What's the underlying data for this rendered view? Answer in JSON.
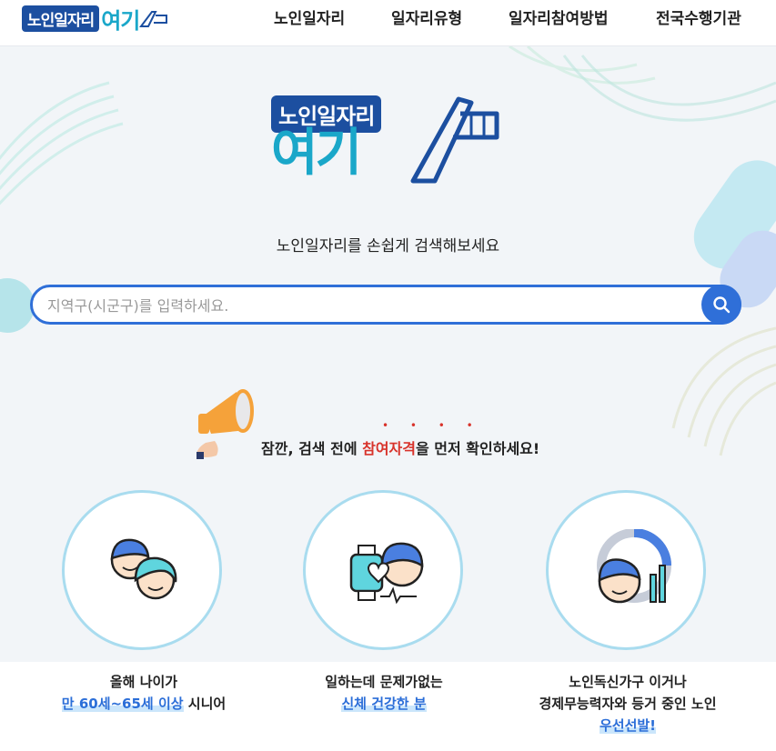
{
  "header": {
    "logo_tag": "노인일자리",
    "logo_big": "여기",
    "nav": [
      "노인일자리",
      "일자리유형",
      "일자리참여방법",
      "전국수행기관"
    ]
  },
  "hero": {
    "logo_tag": "노인일자리",
    "logo_big": "여기",
    "tagline": "노인일자리를 손쉽게 검색해보세요",
    "search_placeholder": "지역구(시군구)를 입력하세요.",
    "notice_pre": "잠깐, 검색 전에 ",
    "notice_emph": "참여자격",
    "notice_post": "을 먼저 확인하세요!",
    "notice_dots": "• • • •"
  },
  "criteria": [
    {
      "line1": "올해 나이가",
      "hl": "만 60세~65세 이상",
      "post": " 시니어"
    },
    {
      "line1": "일하는데 문제가없는",
      "hl": "신체 건강한 분",
      "post": ""
    },
    {
      "line1": "노인독신가구 이거나",
      "line2": "경제무능력자와 등거 중인 노인",
      "hl": "우선선발!"
    }
  ],
  "colors": {
    "brand_blue": "#1c4fa0",
    "brand_teal": "#1aa7c9",
    "accent_blue": "#2f6fd8",
    "accent_red": "#d8332b"
  }
}
